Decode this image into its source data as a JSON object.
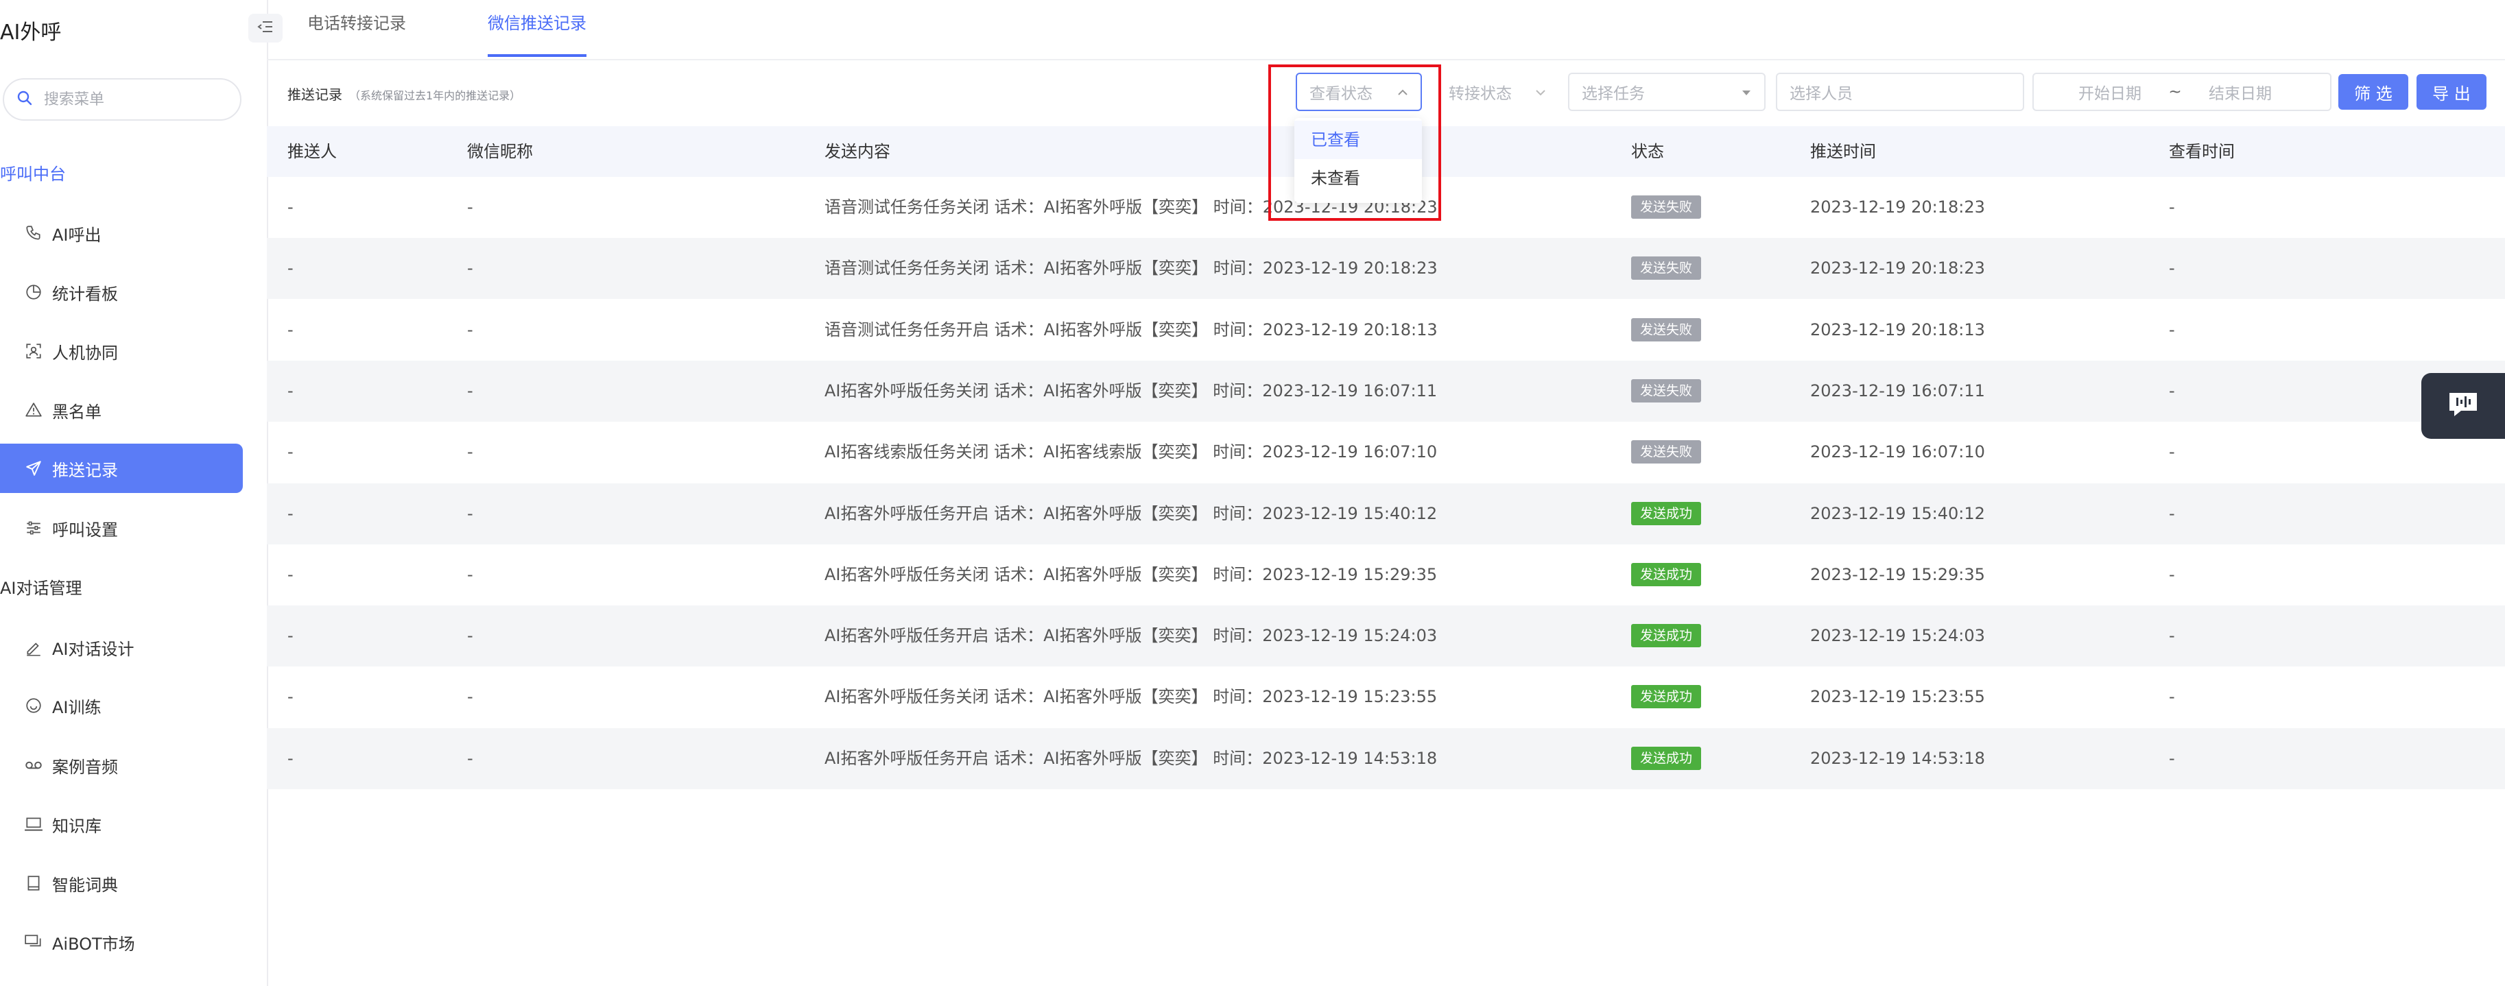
{
  "app": {
    "title": "AI外呼"
  },
  "sidebar": {
    "search_placeholder": "搜索菜单",
    "groups": [
      {
        "title": "呼叫中台",
        "items": [
          {
            "label": "AI呼出",
            "icon": "phone-icon"
          },
          {
            "label": "统计看板",
            "icon": "pie-chart-icon"
          },
          {
            "label": "人机协同",
            "icon": "face-scan-icon"
          },
          {
            "label": "黑名单",
            "icon": "warning-icon"
          },
          {
            "label": "推送记录",
            "icon": "send-icon",
            "active": true
          },
          {
            "label": "呼叫设置",
            "icon": "sliders-icon"
          }
        ]
      },
      {
        "title": "AI对话管理",
        "items": [
          {
            "label": "AI对话设计",
            "icon": "pen-icon"
          },
          {
            "label": "AI训练",
            "icon": "smile-icon"
          },
          {
            "label": "案例音频",
            "icon": "voicemail-icon"
          },
          {
            "label": "知识库",
            "icon": "laptop-icon"
          },
          {
            "label": "智能词典",
            "icon": "book-icon"
          },
          {
            "label": "AiBOT市场",
            "icon": "chat-bubbles-icon"
          }
        ]
      }
    ]
  },
  "tabs": [
    {
      "label": "电话转接记录",
      "active": false
    },
    {
      "label": "微信推送记录",
      "active": true
    }
  ],
  "filter": {
    "title": "推送记录",
    "note": "（系统保留过去1年内的推送记录）",
    "view_status_placeholder": "查看状态",
    "transfer_status_placeholder": "转接状态",
    "task_placeholder": "选择任务",
    "person_placeholder": "选择人员",
    "start_date_placeholder": "开始日期",
    "date_separator": "~",
    "end_date_placeholder": "结束日期",
    "filter_button": "筛 选",
    "export_button": "导 出",
    "dropdown_options": [
      "已查看",
      "未查看"
    ],
    "highlight_color": "#e8101a"
  },
  "table": {
    "headers": [
      "推送人",
      "微信昵称",
      "发送内容",
      "状态",
      "推送时间",
      "查看时间"
    ],
    "rows": [
      {
        "pusher": "-",
        "nickname": "-",
        "content": "语音测试任务任务关闭 话术：AI拓客外呼版【奕奕】 时间：2023-12-19 20:18:23",
        "status": "发送失败",
        "status_type": "fail",
        "push_time": "2023-12-19 20:18:23",
        "view_time": "-"
      },
      {
        "pusher": "-",
        "nickname": "-",
        "content": "语音测试任务任务关闭 话术：AI拓客外呼版【奕奕】 时间：2023-12-19 20:18:23",
        "status": "发送失败",
        "status_type": "fail",
        "push_time": "2023-12-19 20:18:23",
        "view_time": "-"
      },
      {
        "pusher": "-",
        "nickname": "-",
        "content": "语音测试任务任务开启 话术：AI拓客外呼版【奕奕】 时间：2023-12-19 20:18:13",
        "status": "发送失败",
        "status_type": "fail",
        "push_time": "2023-12-19 20:18:13",
        "view_time": "-"
      },
      {
        "pusher": "-",
        "nickname": "-",
        "content": "AI拓客外呼版任务关闭 话术：AI拓客外呼版【奕奕】 时间：2023-12-19 16:07:11",
        "status": "发送失败",
        "status_type": "fail",
        "push_time": "2023-12-19 16:07:11",
        "view_time": "-"
      },
      {
        "pusher": "-",
        "nickname": "-",
        "content": "AI拓客线索版任务关闭 话术：AI拓客线索版【奕奕】 时间：2023-12-19 16:07:10",
        "status": "发送失败",
        "status_type": "fail",
        "push_time": "2023-12-19 16:07:10",
        "view_time": "-"
      },
      {
        "pusher": "-",
        "nickname": "-",
        "content": "AI拓客外呼版任务开启 话术：AI拓客外呼版【奕奕】 时间：2023-12-19 15:40:12",
        "status": "发送成功",
        "status_type": "ok",
        "push_time": "2023-12-19 15:40:12",
        "view_time": "-"
      },
      {
        "pusher": "-",
        "nickname": "-",
        "content": "AI拓客外呼版任务关闭 话术：AI拓客外呼版【奕奕】 时间：2023-12-19 15:29:35",
        "status": "发送成功",
        "status_type": "ok",
        "push_time": "2023-12-19 15:29:35",
        "view_time": "-"
      },
      {
        "pusher": "-",
        "nickname": "-",
        "content": "AI拓客外呼版任务开启 话术：AI拓客外呼版【奕奕】 时间：2023-12-19 15:24:03",
        "status": "发送成功",
        "status_type": "ok",
        "push_time": "2023-12-19 15:24:03",
        "view_time": "-"
      },
      {
        "pusher": "-",
        "nickname": "-",
        "content": "AI拓客外呼版任务关闭 话术：AI拓客外呼版【奕奕】 时间：2023-12-19 15:23:55",
        "status": "发送成功",
        "status_type": "ok",
        "push_time": "2023-12-19 15:23:55",
        "view_time": "-"
      },
      {
        "pusher": "-",
        "nickname": "-",
        "content": "AI拓客外呼版任务开启 话术：AI拓客外呼版【奕奕】 时间：2023-12-19 14:53:18",
        "status": "发送成功",
        "status_type": "ok",
        "push_time": "2023-12-19 14:53:18",
        "view_time": "-"
      }
    ]
  },
  "float_button": {
    "icon": "chat-support-icon"
  },
  "colors": {
    "accent": "#5b7cf6",
    "success": "#4caf3e",
    "fail": "#a1a4ad",
    "highlight": "#e8101a",
    "float_bg": "#2e3441"
  }
}
